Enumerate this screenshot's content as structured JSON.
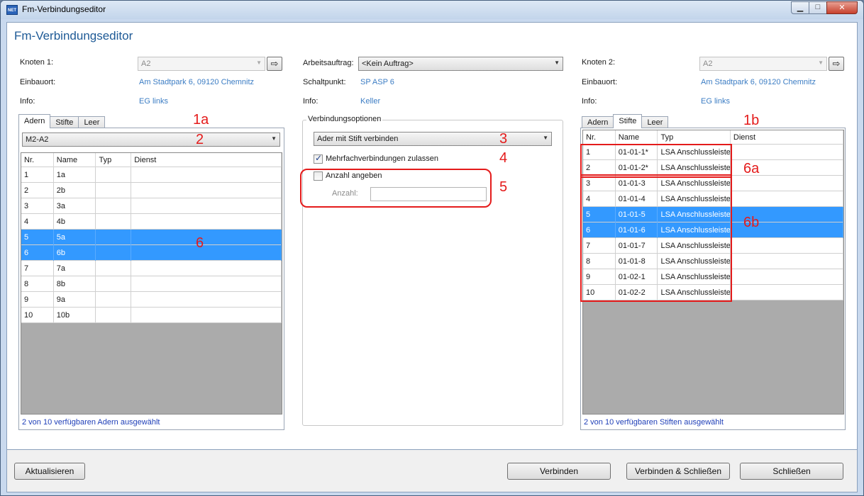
{
  "window": {
    "title": "Fm-Verbindungseditor",
    "app_icon_text": "NET"
  },
  "page_title": "Fm-Verbindungseditor",
  "left": {
    "node_label": "Knoten 1:",
    "node_value": "A2",
    "location_label": "Einbauort:",
    "location_value": "Am Stadtpark 6, 09120 Chemnitz",
    "info_label": "Info:",
    "info_value": "EG links",
    "tabs": [
      "Adern",
      "Stifte",
      "Leer"
    ],
    "active_tab": "Adern",
    "cable_select": "M2-A2",
    "columns": [
      "Nr.",
      "Name",
      "Typ",
      "Dienst"
    ],
    "rows": [
      {
        "nr": "1",
        "name": "1a",
        "typ": "",
        "dienst": "",
        "selected": false
      },
      {
        "nr": "2",
        "name": "2b",
        "typ": "",
        "dienst": "",
        "selected": false
      },
      {
        "nr": "3",
        "name": "3a",
        "typ": "",
        "dienst": "",
        "selected": false
      },
      {
        "nr": "4",
        "name": "4b",
        "typ": "",
        "dienst": "",
        "selected": false
      },
      {
        "nr": "5",
        "name": "5a",
        "typ": "",
        "dienst": "",
        "selected": true
      },
      {
        "nr": "6",
        "name": "6b",
        "typ": "",
        "dienst": "",
        "selected": true
      },
      {
        "nr": "7",
        "name": "7a",
        "typ": "",
        "dienst": "",
        "selected": false
      },
      {
        "nr": "8",
        "name": "8b",
        "typ": "",
        "dienst": "",
        "selected": false
      },
      {
        "nr": "9",
        "name": "9a",
        "typ": "",
        "dienst": "",
        "selected": false
      },
      {
        "nr": "10",
        "name": "10b",
        "typ": "",
        "dienst": "",
        "selected": false
      }
    ],
    "status": "2 von 10 verfügbaren Adern ausgewählt"
  },
  "middle": {
    "order_label": "Arbeitsauftrag:",
    "order_value": "<Kein Auftrag>",
    "switchpoint_label": "Schaltpunkt:",
    "switchpoint_value": "SP ASP 6",
    "info_label": "Info:",
    "info_value": "Keller",
    "options_title": "Verbindungsoptionen",
    "connect_mode": "Ader mit Stift verbinden",
    "multi_label": "Mehrfachverbindungen zulassen",
    "multi_checked": true,
    "count_label": "Anzahl angeben",
    "count_checked": false,
    "count_field_label": "Anzahl:",
    "count_value": ""
  },
  "right": {
    "node_label": "Knoten 2:",
    "node_value": "A2",
    "location_label": "Einbauort:",
    "location_value": "Am Stadtpark 6, 09120 Chemnitz",
    "info_label": "Info:",
    "info_value": "EG links",
    "tabs": [
      "Adern",
      "Stifte",
      "Leer"
    ],
    "active_tab": "Stifte",
    "columns": [
      "Nr.",
      "Name",
      "Typ",
      "Dienst"
    ],
    "rows": [
      {
        "nr": "1",
        "name": "01-01-1*",
        "typ": "LSA Anschlussleiste",
        "dienst": "",
        "selected": false
      },
      {
        "nr": "2",
        "name": "01-01-2*",
        "typ": "LSA Anschlussleiste",
        "dienst": "",
        "selected": false
      },
      {
        "nr": "3",
        "name": "01-01-3",
        "typ": "LSA Anschlussleiste",
        "dienst": "",
        "selected": false
      },
      {
        "nr": "4",
        "name": "01-01-4",
        "typ": "LSA Anschlussleiste",
        "dienst": "",
        "selected": false
      },
      {
        "nr": "5",
        "name": "01-01-5",
        "typ": "LSA Anschlussleiste",
        "dienst": "",
        "selected": true
      },
      {
        "nr": "6",
        "name": "01-01-6",
        "typ": "LSA Anschlussleiste",
        "dienst": "",
        "selected": true
      },
      {
        "nr": "7",
        "name": "01-01-7",
        "typ": "LSA Anschlussleiste",
        "dienst": "",
        "selected": false
      },
      {
        "nr": "8",
        "name": "01-01-8",
        "typ": "LSA Anschlussleiste",
        "dienst": "",
        "selected": false
      },
      {
        "nr": "9",
        "name": "01-02-1",
        "typ": "LSA Anschlussleiste",
        "dienst": "",
        "selected": false
      },
      {
        "nr": "10",
        "name": "01-02-2",
        "typ": "LSA Anschlussleiste",
        "dienst": "",
        "selected": false
      }
    ],
    "status": "2 von 10 verfügbaren Stiften ausgewählt"
  },
  "footer": {
    "refresh": "Aktualisieren",
    "connect": "Verbinden",
    "connect_close": "Verbinden & Schließen",
    "close": "Schließen"
  },
  "annotations": {
    "a1a": "1a",
    "a1b": "1b",
    "a2": "2",
    "a3": "3",
    "a4": "4",
    "a5": "5",
    "a6": "6",
    "a6a": "6a",
    "a6b": "6b"
  },
  "colors": {
    "selection": "#3399ff",
    "link_value": "#3c7dc4",
    "title": "#1e5a96",
    "annotation": "#e41b1b",
    "status": "#1f3fb8"
  }
}
